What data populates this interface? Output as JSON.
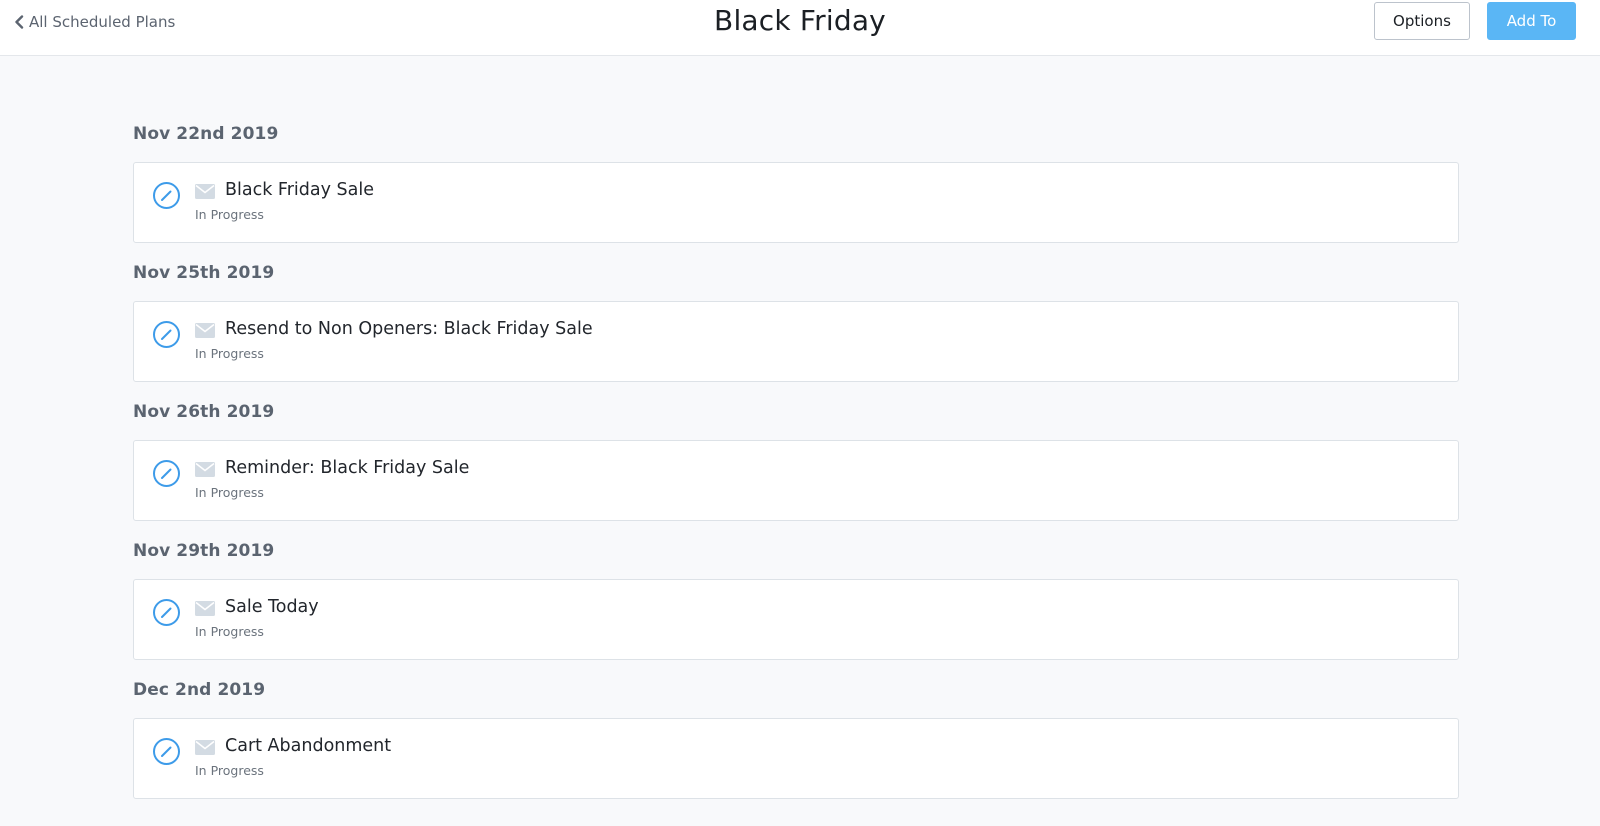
{
  "header": {
    "back_label": "All Scheduled Plans",
    "title": "Black Friday",
    "options_label": "Options",
    "add_label": "Add To"
  },
  "colors": {
    "accent": "#5ab6f5",
    "edit_icon": "#3d9be9",
    "mail_icon": "#d3dbe3",
    "background": "#f8f9fb"
  },
  "icons": {
    "back": "chevron-left-icon",
    "edit": "pencil-circle-icon",
    "message": "envelope-icon"
  },
  "groups": [
    {
      "date": "Nov 22nd 2019",
      "plans": [
        {
          "title": "Black Friday Sale",
          "status": "In Progress"
        }
      ]
    },
    {
      "date": "Nov 25th 2019",
      "plans": [
        {
          "title": "Resend to Non Openers: Black Friday Sale",
          "status": "In Progress"
        }
      ]
    },
    {
      "date": "Nov 26th 2019",
      "plans": [
        {
          "title": "Reminder: Black Friday Sale",
          "status": "In Progress"
        }
      ]
    },
    {
      "date": "Nov 29th 2019",
      "plans": [
        {
          "title": "Sale Today",
          "status": "In Progress"
        }
      ]
    },
    {
      "date": "Dec 2nd 2019",
      "plans": [
        {
          "title": "Cart Abandonment",
          "status": "In Progress"
        }
      ]
    }
  ]
}
